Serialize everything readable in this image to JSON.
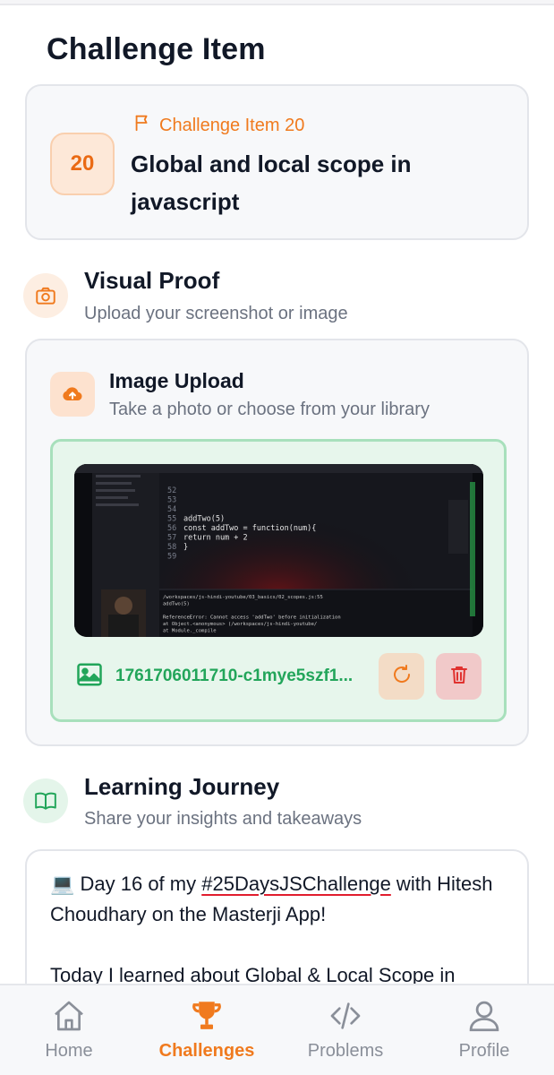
{
  "page": {
    "title": "Challenge Item"
  },
  "challenge": {
    "number": "20",
    "tag": "Challenge Item 20",
    "title": "Global and local scope in javascript"
  },
  "visual_proof": {
    "title": "Visual Proof",
    "subtitle": "Upload your screenshot or image",
    "icon": "camera-icon"
  },
  "image_upload": {
    "title": "Image Upload",
    "subtitle": "Take a photo or choose from your library",
    "icon": "cloud-upload-icon",
    "file_name": "1761706011710-c1mye5szf1...",
    "code_lines": [
      {
        "n": "52",
        "t": ""
      },
      {
        "n": "53",
        "t": ""
      },
      {
        "n": "54",
        "t": ""
      },
      {
        "n": "55",
        "t": "addTwo(5)"
      },
      {
        "n": "56",
        "t": "const addTwo = function(num){"
      },
      {
        "n": "57",
        "t": "    return num + 2"
      },
      {
        "n": "58",
        "t": "}"
      },
      {
        "n": "59",
        "t": ""
      }
    ],
    "terminal_lines": [
      "/workspaces/js-hindi-youtube/03_basics/02_scopes.js:55",
      "addTwo(5)",
      "",
      "ReferenceError: Cannot access 'addTwo' before initialization",
      "    at Object.<anonymous> (/workspaces/js-hindi-youtube/",
      "    at Module._compile"
    ]
  },
  "learning_journey": {
    "title": "Learning Journey",
    "subtitle": "Share your insights and takeaways",
    "icon": "open-book-icon",
    "text_prefix": "💻 Day 16 of my ",
    "hashtag": "#25DaysJSChallenge",
    "text_suffix": " with Hitesh Choudhary on the Masterji App!",
    "text_line2": "Today I learned about Global & Local Scope in"
  },
  "nav": {
    "items": [
      {
        "label": "Home",
        "icon": "home-icon",
        "active": false
      },
      {
        "label": "Challenges",
        "icon": "trophy-icon",
        "active": true
      },
      {
        "label": "Problems",
        "icon": "code-icon",
        "active": false
      },
      {
        "label": "Profile",
        "icon": "user-icon",
        "active": false
      }
    ]
  },
  "colors": {
    "accent": "#f07a1e",
    "success": "#22a55a",
    "danger": "#e0322f"
  }
}
